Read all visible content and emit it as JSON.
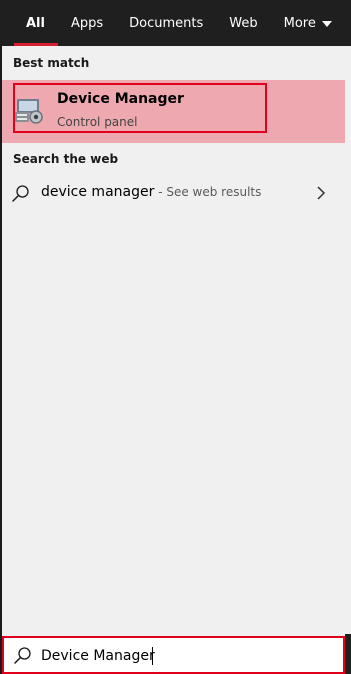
{
  "tabs": [
    {
      "label": "All",
      "active": true
    },
    {
      "label": "Apps"
    },
    {
      "label": "Documents"
    },
    {
      "label": "Web"
    },
    {
      "label": "More"
    }
  ],
  "best_match": {
    "heading": "Best match",
    "title": "Device Manager",
    "subtitle": "Control panel",
    "icon": "device-manager-icon"
  },
  "web": {
    "heading": "Search the web",
    "query": "device manager",
    "suffix": " - See web results",
    "icon": "search-icon"
  },
  "search": {
    "value": "Device Manager",
    "icon": "search-icon"
  },
  "colors": {
    "accent": "#d6202f",
    "highlight": "#eea9b0",
    "outline": "#e0001b"
  }
}
